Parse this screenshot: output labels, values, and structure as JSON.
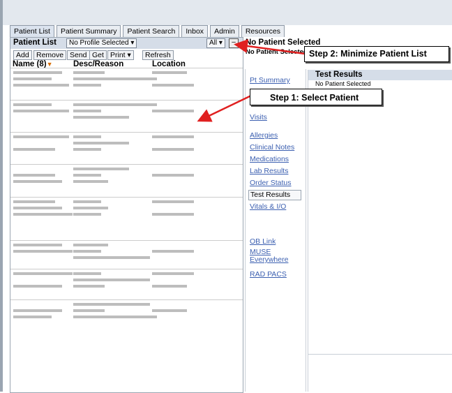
{
  "tabs": [
    "Patient List",
    "Patient Summary",
    "Patient Search",
    "Inbox",
    "Admin",
    "Resources"
  ],
  "patient_list": {
    "title": "Patient List",
    "profile_dropdown": "No Profile Selected ▾",
    "all_dropdown": "All ▾",
    "minimize": "–",
    "buttons": {
      "add": "Add",
      "remove": "Remove",
      "send": "Send",
      "get": "Get",
      "print": "Print ▾",
      "refresh": "Refresh"
    },
    "columns": {
      "name": "Name (8)",
      "sort_icon": "▼",
      "desc": "Desc/Reason",
      "location": "Location"
    }
  },
  "right": {
    "title": "No Patient Selected",
    "subtitle": "No Patient Selected",
    "nav": {
      "pt_summary": "Pt Summary",
      "visits": "Visits",
      "allergies": "Allergies",
      "clinical_notes": "Clinical Notes",
      "medications": "Medications",
      "lab_results": "Lab Results",
      "order_status": "Order Status",
      "test_results": "Test Results",
      "vitals": "Vitals & I/O",
      "ob_link": "OB Link",
      "muse": "MUSE Everywhere",
      "rad_pacs": "RAD PACS"
    },
    "results_title": "Test Results",
    "results_sub": "No Patient Selected"
  },
  "callouts": {
    "step1": "Step 1:  Select Patient",
    "step2": "Step 2:  Minimize Patient List"
  },
  "colors": {
    "arrow": "#e02020",
    "header_bg": "#d5dde8",
    "link": "#3b5fb0"
  }
}
